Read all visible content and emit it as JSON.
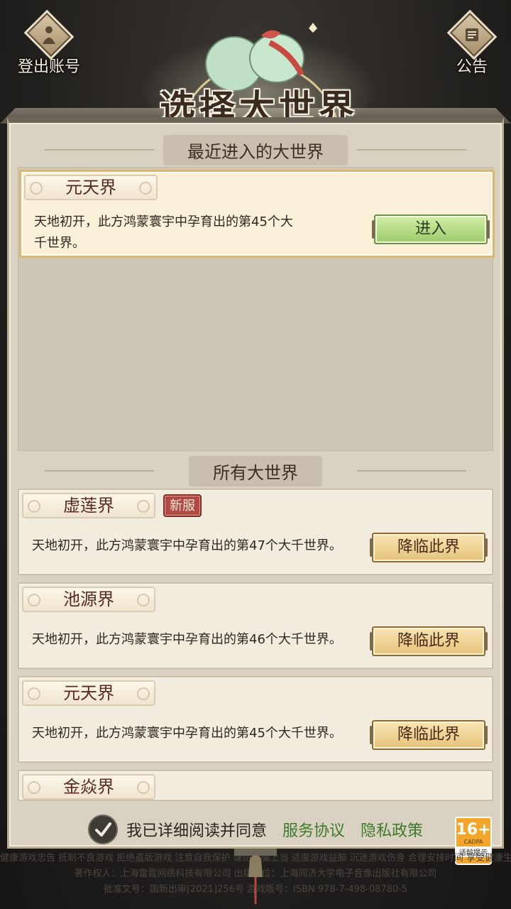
{
  "header": {
    "logout_label": "登出账号",
    "notice_label": "公告",
    "title": "选择大世界"
  },
  "recent": {
    "section_title": "最近进入的大世界",
    "card": {
      "name": "元天界",
      "desc_line1": "天地初开，此方鸿蒙寰宇中孕育出的第45个大",
      "desc_line2": "千世界。",
      "button": "进入"
    }
  },
  "all": {
    "section_title": "所有大世界",
    "items": [
      {
        "name": "虚莲界",
        "badge": "新服",
        "desc": "天地初开，此方鸿蒙寰宇中孕育出的第47个大千世界。",
        "button": "降临此界"
      },
      {
        "name": "池源界",
        "desc": "天地初开，此方鸿蒙寰宇中孕育出的第46个大千世界。",
        "button": "降临此界"
      },
      {
        "name": "元天界",
        "desc": "天地初开，此方鸿蒙寰宇中孕育出的第45个大千世界。",
        "button": "降临此界"
      },
      {
        "name": "金焱界"
      }
    ]
  },
  "agreement": {
    "text": "我已详细阅读并同意",
    "service_link": "服务协议",
    "privacy_link": "隐私政策"
  },
  "age_rating": {
    "number": "16+",
    "org": "CADPA",
    "tip": "适龄提示"
  },
  "footer": {
    "line1": "健康游戏忠告  抵制不良游戏  拒绝盗版游戏  注意自我保护  谨防受骗上当  适度游戏益脑  沉迷游戏伤身  合理安排时间  享受健康生活",
    "line2": "著作权人：上海雷霆网络科技有限公司    出版单位：上海同济大学电子音像出版社有限公司",
    "line3": "批准文号：国新出审[2021]256号    游戏版号：ISBN 978-7-498-08780-5"
  }
}
